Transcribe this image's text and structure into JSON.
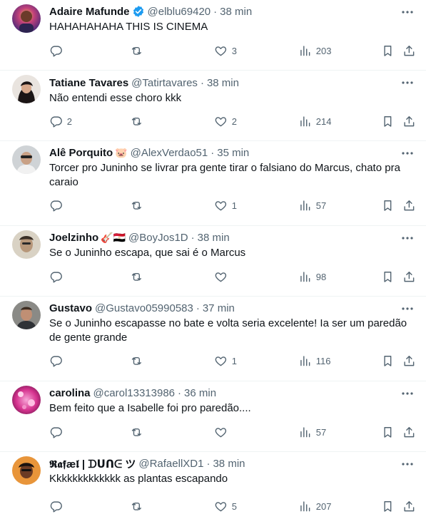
{
  "tweets": [
    {
      "name": "Adaire Mafunde",
      "verified": true,
      "emoji": "",
      "handle": "@elblu69420",
      "time": "38 min",
      "text": "HAHAHAHAHA THIS IS CINEMA",
      "replies": "",
      "retweets": "",
      "likes": "3",
      "views": "203"
    },
    {
      "name": "Tatiane Tavares",
      "verified": false,
      "emoji": "",
      "handle": "@Tatirtavares",
      "time": "38 min",
      "text": "Não entendi esse choro kkk",
      "replies": "2",
      "retweets": "",
      "likes": "2",
      "views": "214"
    },
    {
      "name": "Alê Porquito",
      "verified": false,
      "emoji": "🐷",
      "handle": "@AlexVerdao51",
      "time": "35 min",
      "text": "Torcer pro Juninho se livrar pra gente tirar o falsiano do Marcus, chato pra caraio",
      "replies": "",
      "retweets": "",
      "likes": "1",
      "views": "57"
    },
    {
      "name": "Joelzinho",
      "verified": false,
      "emoji": "🎸🇪🇬",
      "handle": "@BoyJos1D",
      "time": "38 min",
      "text": "Se o Juninho escapa, que sai é o Marcus",
      "replies": "",
      "retweets": "",
      "likes": "",
      "views": "98"
    },
    {
      "name": "Gustavo",
      "verified": false,
      "emoji": "",
      "handle": "@Gustavo05990583",
      "time": "37 min",
      "text": "Se o Juninho escapasse no bate e volta seria excelente! Ia ser um paredão de gente grande",
      "replies": "",
      "retweets": "",
      "likes": "1",
      "views": "116"
    },
    {
      "name": "carolina",
      "verified": false,
      "emoji": "",
      "handle": "@carol13313986",
      "time": "36 min",
      "text": "Bem feito que a Isabelle foi pro paredão....",
      "replies": "",
      "retweets": "",
      "likes": "",
      "views": "57"
    },
    {
      "name": "𝕽𝖆𝖋æ𝖑 | ᗪᑌᑎᕮ ツ",
      "verified": false,
      "emoji": "",
      "handle": "@RafaellXD1",
      "time": "38 min",
      "text": "Kkkkkkkkkkkkk as plantas escapando",
      "replies": "",
      "retweets": "",
      "likes": "5",
      "views": "207"
    }
  ],
  "icons": {
    "reply": "reply-icon",
    "retweet": "retweet-icon",
    "like": "heart-icon",
    "views": "views-icon",
    "bookmark": "bookmark-icon",
    "share": "share-icon",
    "more": "more-icon",
    "verified": "verified-badge-icon"
  },
  "colors": {
    "text": "#0f1419",
    "secondary": "#536471",
    "divider": "#eff3f4",
    "verified": "#1d9bf0"
  }
}
